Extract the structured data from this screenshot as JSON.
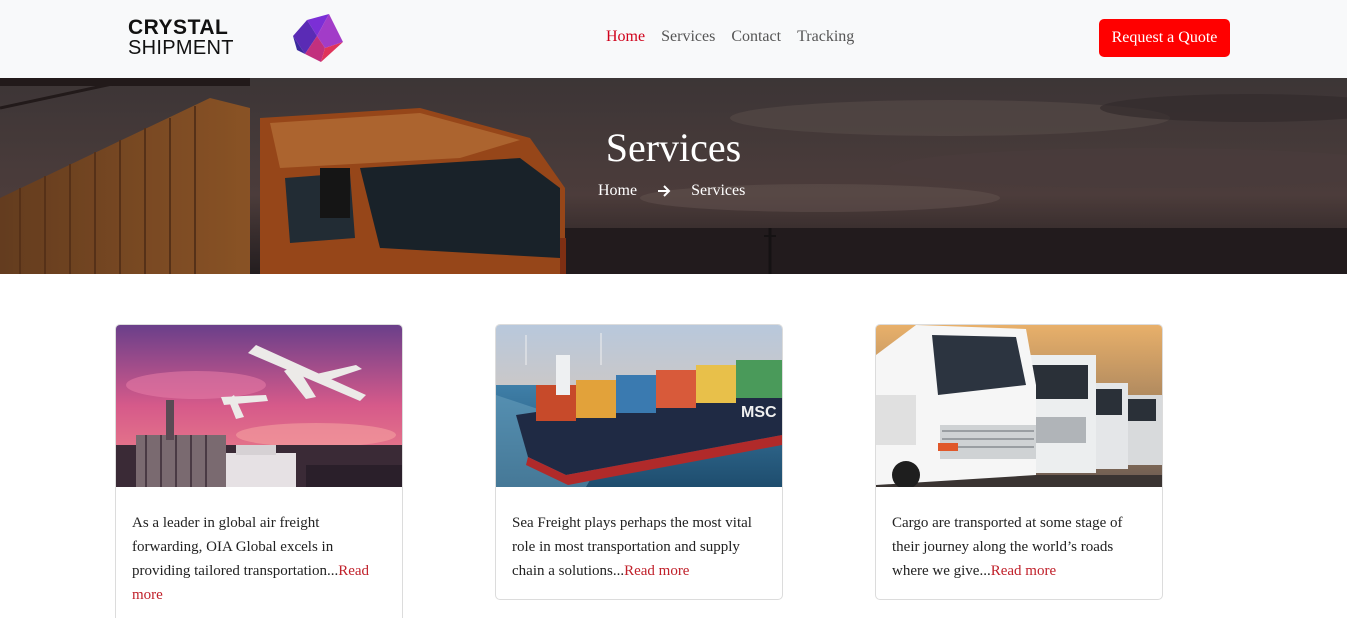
{
  "brand": {
    "line1": "CRYSTAL",
    "line2": "SHIPMENT",
    "logo_icon": "purple-geometric-logo-icon"
  },
  "nav": {
    "items": [
      {
        "label": "Home",
        "active": true
      },
      {
        "label": "Services",
        "active": false
      },
      {
        "label": "Contact",
        "active": false
      },
      {
        "label": "Tracking",
        "active": false
      }
    ],
    "cta_label": "Request a Quote"
  },
  "hero": {
    "title": "Services",
    "breadcrumb": {
      "home": "Home",
      "separator_icon": "arrow-right-icon",
      "current": "Services"
    }
  },
  "cards": [
    {
      "text": "As a leader in global air freight forwarding, OIA Global excels in providing tailored transportation...",
      "link": "Read more",
      "image": "air-freight-plane-image"
    },
    {
      "text": "Sea Freight plays perhaps the most vital role in most transportation and supply chain a solutions...",
      "link": "Read more",
      "image": "container-ship-image"
    },
    {
      "text": "Cargo are transported at some stage of their journey along the world’s roads where we give...",
      "link": "Read more",
      "image": "trucks-image"
    }
  ],
  "colors": {
    "accent": "#d0021b",
    "button": "#ff0000",
    "navbar_bg": "#f8f9fa"
  }
}
